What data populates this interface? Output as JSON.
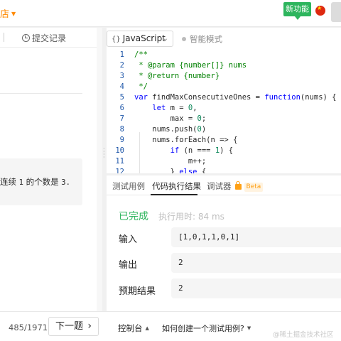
{
  "header": {
    "store_label": "店",
    "new_feature_label": "新功能"
  },
  "left_panel": {
    "submit_records_tab": "提交记录",
    "example_text_prefix": "连续",
    "example_num1": "1",
    "example_text_middle": "的个数是",
    "example_num2": "3."
  },
  "editor": {
    "language": "JavaScript",
    "smart_mode_label": "智能模式",
    "code_lines": [
      {
        "n": "1",
        "html": "<span class=\"cm\">/**</span>"
      },
      {
        "n": "2",
        "html": "<span class=\"cm\"> * @param {number[]} nums</span>"
      },
      {
        "n": "3",
        "html": "<span class=\"cm\"> * @return {number}</span>"
      },
      {
        "n": "4",
        "html": "<span class=\"cm\"> */</span>"
      },
      {
        "n": "5",
        "html": "<span class=\"kw\">var</span> findMaxConsecutiveOnes = <span class=\"kw\">function</span>(nums) {"
      },
      {
        "n": "6",
        "html": "    <span class=\"kw\">let</span> m = <span class=\"nm\">0</span>,"
      },
      {
        "n": "7",
        "html": "        max = <span class=\"nm\">0</span>;"
      },
      {
        "n": "8",
        "html": "    nums.push(<span class=\"nm\">0</span>)"
      },
      {
        "n": "9",
        "html": "    nums.forEach(n =&gt; {"
      },
      {
        "n": "10",
        "html": "        <span class=\"kw\">if</span> (n === <span class=\"nm\">1</span>) {"
      },
      {
        "n": "11",
        "html": "            m++;"
      },
      {
        "n": "12",
        "html": "        } <span class=\"kw\">else</span> {"
      }
    ]
  },
  "results": {
    "tabs": [
      {
        "label": "测试用例"
      },
      {
        "label": "代码执行结果"
      },
      {
        "label": "调试器"
      }
    ],
    "beta_badge": "Beta",
    "status": "已完成",
    "runtime": "执行用时: 84 ms",
    "rows": [
      {
        "label": "输入",
        "value": "[1,0,1,1,0,1]"
      },
      {
        "label": "输出",
        "value": "2"
      },
      {
        "label": "预期结果",
        "value": "2"
      }
    ]
  },
  "footer": {
    "page_info": "485/1971",
    "next_button": "下一题",
    "console_label": "控制台",
    "how_to_create_test": "如何创建一个测试用例?",
    "watermark": "@稀土掘金技术社区"
  }
}
